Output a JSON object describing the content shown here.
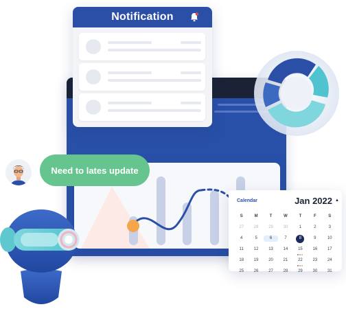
{
  "notification": {
    "title": "Notification",
    "icon": "bell-icon",
    "card_count": 3
  },
  "chat": {
    "message": "Need to lates update",
    "avatar_icon": "user-avatar"
  },
  "calendar": {
    "label": "Calendar",
    "month": "Jan 2022",
    "weekdays": [
      "S",
      "M",
      "T",
      "W",
      "T",
      "F",
      "S"
    ],
    "weeks": [
      [
        "27",
        "28",
        "29",
        "30",
        "1",
        "2",
        "3"
      ],
      [
        "4",
        "5",
        "6",
        "7",
        "8",
        "9",
        "10"
      ],
      [
        "11",
        "12",
        "13",
        "14",
        "15",
        "16",
        "17"
      ],
      [
        "18",
        "19",
        "20",
        "21",
        "22",
        "23",
        "24"
      ],
      [
        "25",
        "26",
        "27",
        "28",
        "29",
        "30",
        "31"
      ]
    ],
    "today": "6",
    "selected": "8"
  },
  "colors": {
    "brand_blue": "#2b4fa6",
    "green": "#66c48e",
    "teal": "#4fc3cf",
    "orange": "#f5a54a",
    "navy": "#1b2a5e"
  }
}
